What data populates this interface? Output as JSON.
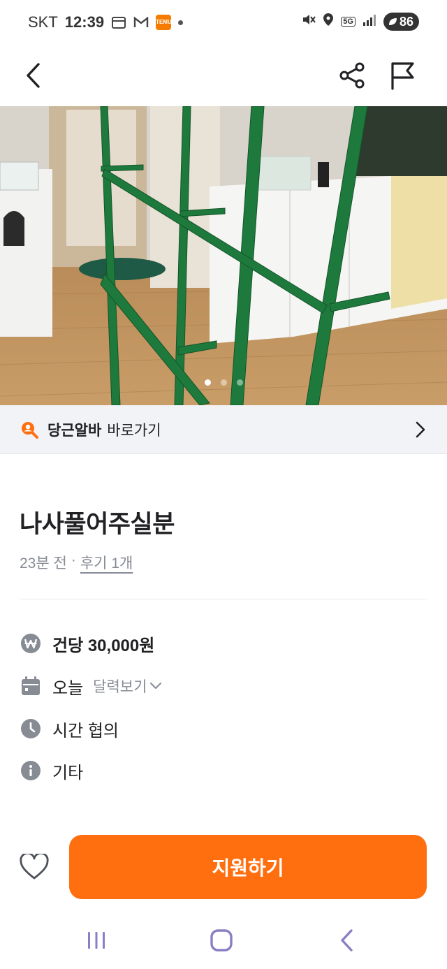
{
  "status_bar": {
    "carrier": "SKT",
    "time": "12:39",
    "temu_label": "TEMU",
    "network": "5G",
    "battery": "86"
  },
  "banner": {
    "name": "당근알바",
    "link": "바로가기"
  },
  "post": {
    "title": "나사풀어주실분",
    "time_ago": "23분 전",
    "separator": "·",
    "reviews": "후기 1개"
  },
  "details": {
    "pay": "건당 30,000원",
    "date": "오늘",
    "calendar_link": "달력보기",
    "time": "시간 협의",
    "category": "기타"
  },
  "photo": {
    "total": 3,
    "current": 1
  },
  "actions": {
    "apply_label": "지원하기"
  },
  "colors": {
    "accent": "#ff6f0f",
    "icon_gray": "#868b94",
    "text": "#212124",
    "banner_bg": "#f2f3f6"
  }
}
